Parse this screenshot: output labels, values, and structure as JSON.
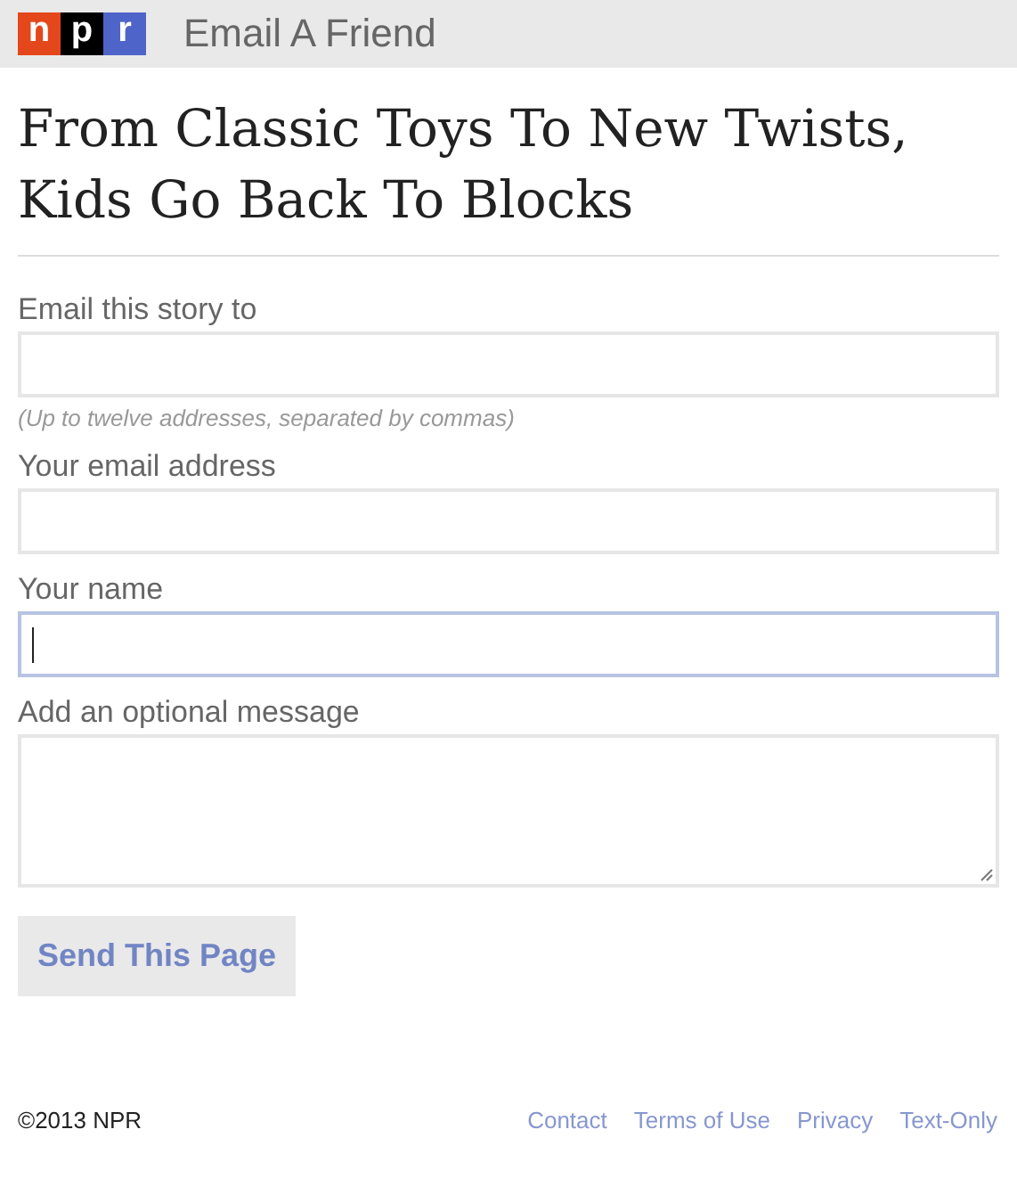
{
  "header": {
    "logo_letters": [
      "n",
      "p",
      "r"
    ],
    "title": "Email A Friend"
  },
  "headline": "From Classic Toys To New Twists, Kids Go Back To Blocks",
  "fields": [
    {
      "kind": "input",
      "label": "Email this story to",
      "hint": "(Up to twelve addresses, separated by commas)",
      "focused": false
    },
    {
      "kind": "input",
      "label": "Your email address",
      "focused": false
    },
    {
      "kind": "input",
      "label": "Your name",
      "focused": true
    },
    {
      "kind": "textarea",
      "label": "Add an optional message",
      "focused": false
    }
  ],
  "submit_button": "Send This Page",
  "footer": {
    "copyright": "©2013 NPR",
    "links": [
      "Contact",
      "Terms of Use",
      "Privacy",
      "Text-Only"
    ]
  }
}
